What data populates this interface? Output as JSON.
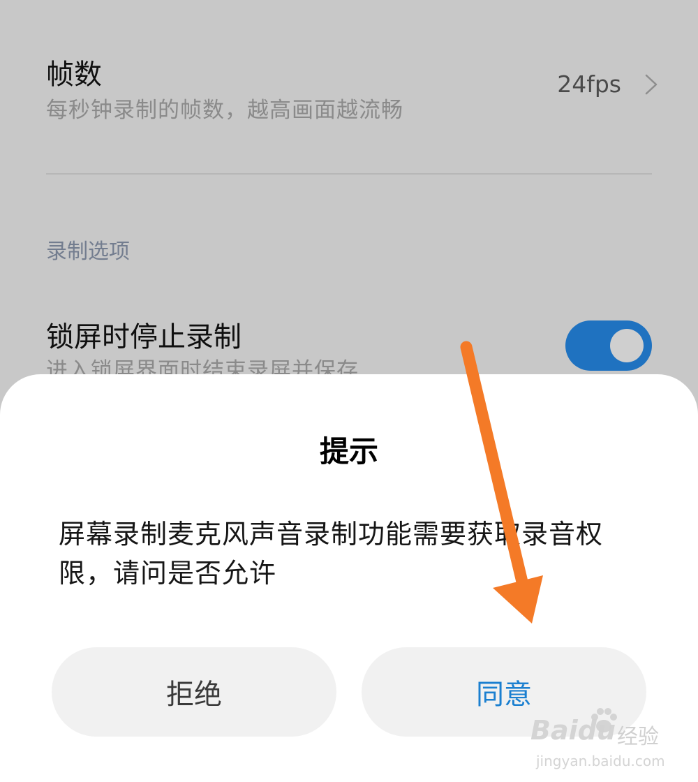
{
  "settings": {
    "framerate": {
      "title": "帧数",
      "description": "每秒钟录制的帧数，越高画面越流畅",
      "value": "24fps"
    },
    "section_header": "录制选项",
    "lockscreen": {
      "title": "锁屏时停止录制",
      "description": "进入锁屏界面时结束录屏并保存",
      "enabled": true
    }
  },
  "dialog": {
    "title": "提示",
    "message": "屏幕录制麦克风声音录制功能需要获取录音权限，请问是否允许",
    "reject_label": "拒绝",
    "accept_label": "同意"
  },
  "watermark": {
    "brand": "Baidu",
    "word": "经验",
    "url": "jingyan.baidu.com"
  },
  "colors": {
    "accent": "#1f72c0",
    "accept_text": "#1a7fd0",
    "arrow": "#f47a27"
  },
  "icons": {
    "chevron": "chevron-right-icon",
    "arrow": "arrow-down-annotation"
  }
}
